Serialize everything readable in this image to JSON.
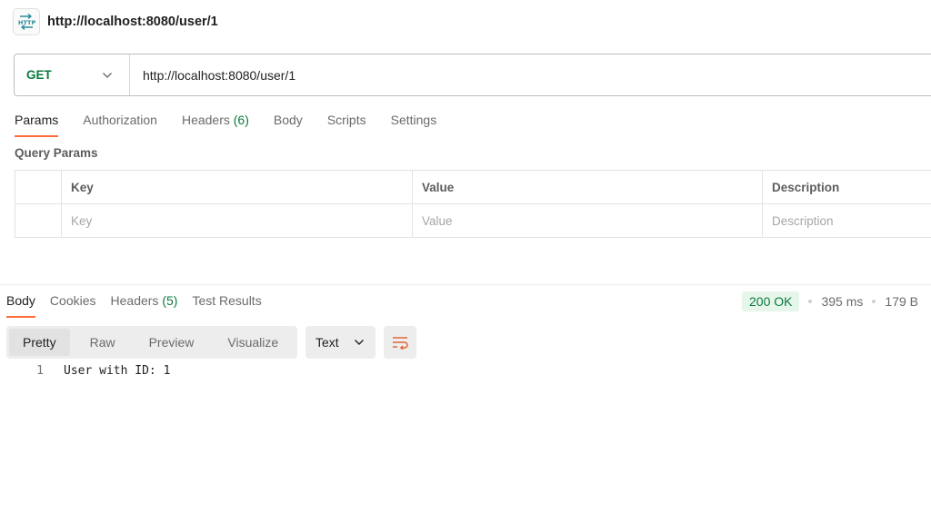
{
  "request": {
    "title": "http://localhost:8080/user/1",
    "method": "GET",
    "url": "http://localhost:8080/user/1"
  },
  "request_tabs": [
    {
      "label": "Params",
      "active": true
    },
    {
      "label": "Authorization"
    },
    {
      "label": "Headers",
      "count": "(6)"
    },
    {
      "label": "Body"
    },
    {
      "label": "Scripts"
    },
    {
      "label": "Settings"
    }
  ],
  "query_params": {
    "section_title": "Query Params",
    "columns": [
      "Key",
      "Value",
      "Description"
    ],
    "placeholders": [
      "Key",
      "Value",
      "Description"
    ]
  },
  "response_tabs": [
    {
      "label": "Body",
      "active": true
    },
    {
      "label": "Cookies"
    },
    {
      "label": "Headers",
      "count": "(5)"
    },
    {
      "label": "Test Results"
    }
  ],
  "response_status": {
    "status": "200 OK",
    "time": "395 ms",
    "size": "179 B"
  },
  "format_options": [
    "Pretty",
    "Raw",
    "Preview",
    "Visualize"
  ],
  "format_type": "Text",
  "response_body": {
    "line_number": "1",
    "line_text": "User with ID: 1"
  },
  "colors": {
    "accent": "#ff6c37",
    "method_green": "#0b7a3e"
  }
}
